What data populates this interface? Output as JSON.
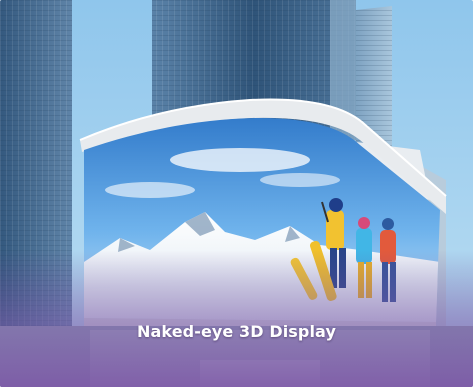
{
  "caption": "Naked-eye 3D Display",
  "colors": {
    "sky": "#9fcfee",
    "glass_dark": "#2e5378",
    "glass_light": "#7fa6c6",
    "billboard_frame": "#eef0f2",
    "overlay_purple": "#7a5aa8"
  }
}
